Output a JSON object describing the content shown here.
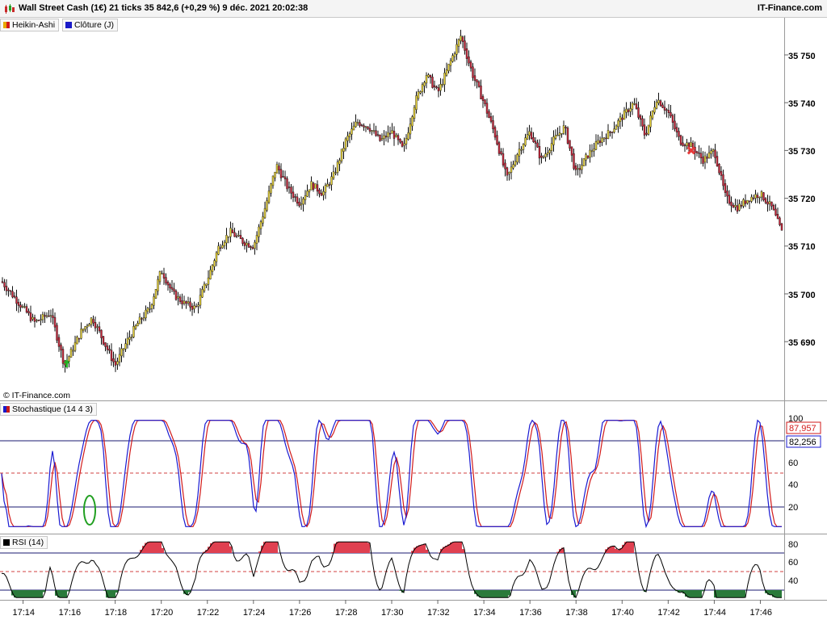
{
  "header": {
    "title": "Wall Street Cash (1€) 21 ticks 35 842,6 (+0,29 %) 9 déc. 2021 20:02:38",
    "brand": "IT-Finance.com"
  },
  "legend": {
    "heikin_ashi": "Heikin-Ashi",
    "close": "Clôture (J)"
  },
  "copyright": "© IT-Finance.com",
  "price_axis": {
    "ticks": [
      "35 750",
      "35 740",
      "35 730",
      "35 720",
      "35 710",
      "35 700",
      "35 690"
    ]
  },
  "stochastic": {
    "label": "Stochastique (14 4 3)",
    "ticks": [
      "100",
      "60",
      "40",
      "20"
    ],
    "value_red": "87,957",
    "value_blue": "82,256"
  },
  "rsi": {
    "label": "RSI (14)",
    "ticks": [
      "80",
      "60",
      "40"
    ]
  },
  "time_axis": {
    "ticks": [
      "17:14",
      "17:16",
      "17:18",
      "17:20",
      "17:22",
      "17:24",
      "17:26",
      "17:28",
      "17:30",
      "17:32",
      "17:34",
      "17:36",
      "17:38",
      "17:40",
      "17:42",
      "17:44",
      "17:46"
    ]
  },
  "colors": {
    "bull": "#e8d23a",
    "bear": "#c8283c",
    "stoch_k": "#1a1ad2",
    "stoch_d": "#d21a1a",
    "buy_marker": "#22b022",
    "sell_marker": "#e83a3a"
  },
  "chart_data": [
    {
      "type": "candlestick",
      "style": "Heikin-Ashi",
      "y_range": [
        35680,
        35755
      ],
      "y_ticks": [
        35690,
        35700,
        35710,
        35720,
        35730,
        35740,
        35750
      ],
      "x_range": [
        "17:13",
        "17:47"
      ],
      "close_path": [
        [
          "17:13",
          35703
        ],
        [
          "17:14",
          35697
        ],
        [
          "17:14.5",
          35694
        ],
        [
          "17:15.2",
          35696
        ],
        [
          "17:15.8",
          35685
        ],
        [
          "17:16",
          35687
        ],
        [
          "17:16.5",
          35692
        ],
        [
          "17:17",
          35695
        ],
        [
          "17:17.5",
          35690
        ],
        [
          "17:18",
          35685
        ],
        [
          "17:18.5",
          35690
        ],
        [
          "17:19",
          35694
        ],
        [
          "17:19.5",
          35697
        ],
        [
          "17:20",
          35705
        ],
        [
          "17:20.5",
          35700
        ],
        [
          "17:21",
          35698
        ],
        [
          "17:21.5",
          35697
        ],
        [
          "17:22",
          35703
        ],
        [
          "17:22.5",
          35710
        ],
        [
          "17:23",
          35713
        ],
        [
          "17:23.5",
          35711
        ],
        [
          "17:24",
          35710
        ],
        [
          "17:24.5",
          35718
        ],
        [
          "17:25",
          35727
        ],
        [
          "17:25.5",
          35722
        ],
        [
          "17:26",
          35719
        ],
        [
          "17:26.5",
          35723
        ],
        [
          "17:27",
          35721
        ],
        [
          "17:27.5",
          35725
        ],
        [
          "17:28",
          35732
        ],
        [
          "17:28.5",
          35736
        ],
        [
          "17:29",
          35735
        ],
        [
          "17:29.5",
          35732
        ],
        [
          "17:30",
          35734
        ],
        [
          "17:30.5",
          35730
        ],
        [
          "17:31",
          35740
        ],
        [
          "17:31.5",
          35746
        ],
        [
          "17:32",
          35742
        ],
        [
          "17:32.5",
          35748
        ],
        [
          "17:33",
          35754
        ],
        [
          "17:33.5",
          35746
        ],
        [
          "17:34",
          35740
        ],
        [
          "17:34.5",
          35733
        ],
        [
          "17:35",
          35724
        ],
        [
          "17:35.5",
          35730
        ],
        [
          "17:36",
          35734
        ],
        [
          "17:36.5",
          35728
        ],
        [
          "17:37",
          35732
        ],
        [
          "17:37.5",
          35735
        ],
        [
          "17:38",
          35725
        ],
        [
          "17:38.5",
          35729
        ],
        [
          "17:39",
          35732
        ],
        [
          "17:39.5",
          35734
        ],
        [
          "17:40",
          35737
        ],
        [
          "17:40.5",
          35740
        ],
        [
          "17:41",
          35733
        ],
        [
          "17:41.5",
          35741
        ],
        [
          "17:42",
          35738
        ],
        [
          "17:42.5",
          35732
        ],
        [
          "17:43",
          35731
        ],
        [
          "17:43.5",
          35728
        ],
        [
          "17:44",
          35730
        ],
        [
          "17:44.5",
          35720
        ],
        [
          "17:45",
          35718
        ],
        [
          "17:45.5",
          35720
        ],
        [
          "17:46",
          35721
        ],
        [
          "17:46.5",
          35718
        ],
        [
          "17:47",
          35712
        ]
      ],
      "annotations": [
        {
          "type": "buy-arrow",
          "time": "17:16",
          "price": 35687
        },
        {
          "type": "sell-cross",
          "time": "17:43",
          "price": 35730
        }
      ]
    },
    {
      "type": "line",
      "name": "Stochastique (14 4 3)",
      "y_range": [
        0,
        100
      ],
      "levels": [
        20,
        50,
        80
      ],
      "last": {
        "red": 87.957,
        "blue": 82.256
      }
    },
    {
      "type": "line",
      "name": "RSI (14)",
      "y_range": [
        20,
        90
      ],
      "levels": [
        30,
        50,
        70
      ]
    }
  ]
}
